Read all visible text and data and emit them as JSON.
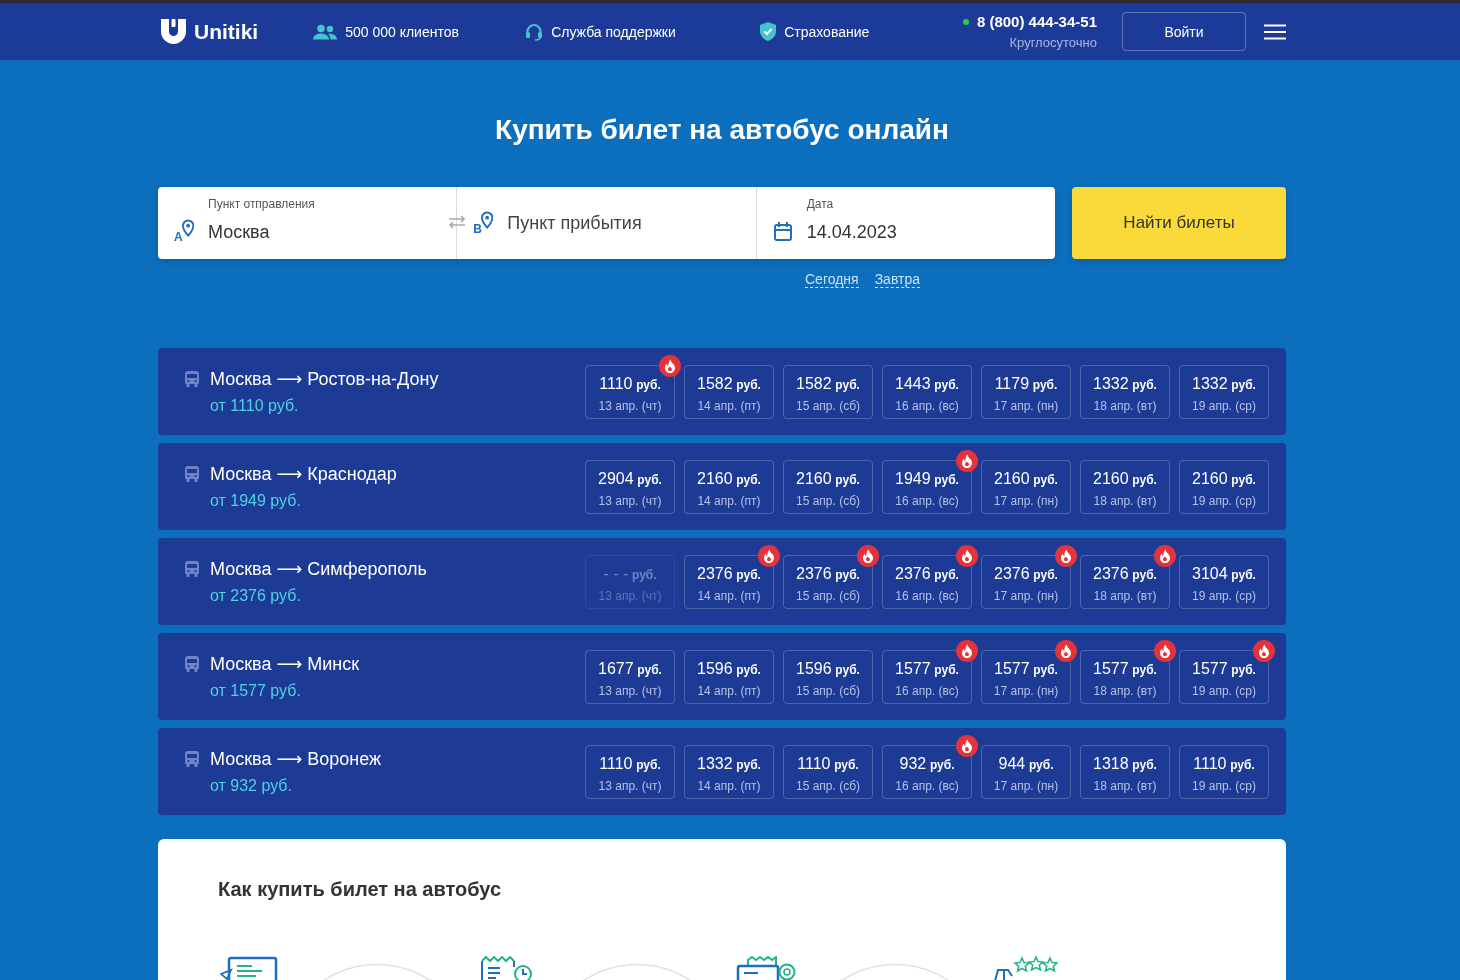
{
  "header": {
    "logo": "Unitiki",
    "nav": [
      {
        "kind": "clients",
        "label": "500 000 клиентов"
      },
      {
        "kind": "support",
        "label": "Служба поддержки"
      },
      {
        "kind": "insurance",
        "label": "Страхование"
      }
    ],
    "phone": {
      "number": "8 (800) 444-34-51",
      "hours": "Круглосуточно"
    },
    "login_button": "Войти"
  },
  "hero": {
    "title": "Купить билет на автобус онлайн"
  },
  "search": {
    "fields": [
      {
        "kind": "from",
        "marker": "A",
        "label": "Пункт отправления",
        "value": "Москва"
      },
      {
        "kind": "to",
        "marker": "B",
        "placeholder": "Пункт прибытия"
      },
      {
        "kind": "date",
        "label": "Дата",
        "value": "14.04.2023"
      }
    ],
    "button": "Найти билеты",
    "quick_dates": [
      "Сегодня",
      "Завтра"
    ]
  },
  "routes": [
    {
      "title": "Москва ⟶ Ростов-на-Дону",
      "min_price": "от 1110 руб.",
      "prices": [
        {
          "price": "1110",
          "currency": "руб.",
          "date": "13 апр. (чт)",
          "hot": true,
          "disabled": false
        },
        {
          "price": "1582",
          "currency": "руб.",
          "date": "14 апр. (пт)",
          "hot": false,
          "disabled": false
        },
        {
          "price": "1582",
          "currency": "руб.",
          "date": "15 апр. (сб)",
          "hot": false,
          "disabled": false
        },
        {
          "price": "1443",
          "currency": "руб.",
          "date": "16 апр. (вс)",
          "hot": false,
          "disabled": false
        },
        {
          "price": "1179",
          "currency": "руб.",
          "date": "17 апр. (пн)",
          "hot": false,
          "disabled": false
        },
        {
          "price": "1332",
          "currency": "руб.",
          "date": "18 апр. (вт)",
          "hot": false,
          "disabled": false
        },
        {
          "price": "1332",
          "currency": "руб.",
          "date": "19 апр. (ср)",
          "hot": false,
          "disabled": false
        }
      ]
    },
    {
      "title": "Москва ⟶ Краснодар",
      "min_price": "от 1949 руб.",
      "prices": [
        {
          "price": "2904",
          "currency": "руб.",
          "date": "13 апр. (чт)",
          "hot": false,
          "disabled": false
        },
        {
          "price": "2160",
          "currency": "руб.",
          "date": "14 апр. (пт)",
          "hot": false,
          "disabled": false
        },
        {
          "price": "2160",
          "currency": "руб.",
          "date": "15 апр. (сб)",
          "hot": false,
          "disabled": false
        },
        {
          "price": "1949",
          "currency": "руб.",
          "date": "16 апр. (вс)",
          "hot": true,
          "disabled": false
        },
        {
          "price": "2160",
          "currency": "руб.",
          "date": "17 апр. (пн)",
          "hot": false,
          "disabled": false
        },
        {
          "price": "2160",
          "currency": "руб.",
          "date": "18 апр. (вт)",
          "hot": false,
          "disabled": false
        },
        {
          "price": "2160",
          "currency": "руб.",
          "date": "19 апр. (ср)",
          "hot": false,
          "disabled": false
        }
      ]
    },
    {
      "title": "Москва ⟶ Симферополь",
      "min_price": "от 2376 руб.",
      "prices": [
        {
          "price": "- - -",
          "currency": "руб.",
          "date": "13 апр. (чт)",
          "hot": false,
          "disabled": true
        },
        {
          "price": "2376",
          "currency": "руб.",
          "date": "14 апр. (пт)",
          "hot": true,
          "disabled": false
        },
        {
          "price": "2376",
          "currency": "руб.",
          "date": "15 апр. (сб)",
          "hot": true,
          "disabled": false
        },
        {
          "price": "2376",
          "currency": "руб.",
          "date": "16 апр. (вс)",
          "hot": true,
          "disabled": false
        },
        {
          "price": "2376",
          "currency": "руб.",
          "date": "17 апр. (пн)",
          "hot": true,
          "disabled": false
        },
        {
          "price": "2376",
          "currency": "руб.",
          "date": "18 апр. (вт)",
          "hot": true,
          "disabled": false
        },
        {
          "price": "3104",
          "currency": "руб.",
          "date": "19 апр. (ср)",
          "hot": false,
          "disabled": false
        }
      ]
    },
    {
      "title": "Москва ⟶ Минск",
      "min_price": "от 1577 руб.",
      "prices": [
        {
          "price": "1677",
          "currency": "руб.",
          "date": "13 апр. (чт)",
          "hot": false,
          "disabled": false
        },
        {
          "price": "1596",
          "currency": "руб.",
          "date": "14 апр. (пт)",
          "hot": false,
          "disabled": false
        },
        {
          "price": "1596",
          "currency": "руб.",
          "date": "15 апр. (сб)",
          "hot": false,
          "disabled": false
        },
        {
          "price": "1577",
          "currency": "руб.",
          "date": "16 апр. (вс)",
          "hot": true,
          "disabled": false
        },
        {
          "price": "1577",
          "currency": "руб.",
          "date": "17 апр. (пн)",
          "hot": true,
          "disabled": false
        },
        {
          "price": "1577",
          "currency": "руб.",
          "date": "18 апр. (вт)",
          "hot": true,
          "disabled": false
        },
        {
          "price": "1577",
          "currency": "руб.",
          "date": "19 апр. (ср)",
          "hot": true,
          "disabled": false
        }
      ]
    },
    {
      "title": "Москва ⟶ Воронеж",
      "min_price": "от 932 руб.",
      "prices": [
        {
          "price": "1110",
          "currency": "руб.",
          "date": "13 апр. (чт)",
          "hot": false,
          "disabled": false
        },
        {
          "price": "1332",
          "currency": "руб.",
          "date": "14 апр. (пт)",
          "hot": false,
          "disabled": false
        },
        {
          "price": "1110",
          "currency": "руб.",
          "date": "15 апр. (сб)",
          "hot": false,
          "disabled": false
        },
        {
          "price": "932",
          "currency": "руб.",
          "date": "16 апр. (вс)",
          "hot": true,
          "disabled": false
        },
        {
          "price": "944",
          "currency": "руб.",
          "date": "17 апр. (пн)",
          "hot": false,
          "disabled": false
        },
        {
          "price": "1318",
          "currency": "руб.",
          "date": "18 апр. (вт)",
          "hot": false,
          "disabled": false
        },
        {
          "price": "1110",
          "currency": "руб.",
          "date": "19 апр. (ср)",
          "hot": false,
          "disabled": false
        }
      ]
    }
  ],
  "how_to": {
    "title": "Как купить билет на автобус",
    "steps": [
      {
        "kind": "form"
      },
      {
        "kind": "schedule"
      },
      {
        "kind": "payment"
      },
      {
        "kind": "rating"
      }
    ]
  }
}
